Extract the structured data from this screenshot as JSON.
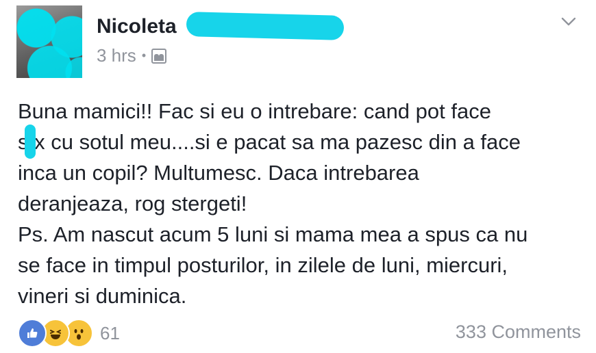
{
  "author": {
    "name": "Nicoleta",
    "time": "3 hrs",
    "separator": "•",
    "privacy_icon": "friends-icon"
  },
  "menu_icon": "chevron-down-icon",
  "post": {
    "lines": [
      "Buna mamici!! Fac si eu o intrebare: cand pot face",
      "s  x cu sotul meu....si e pacat sa ma pazesc din a face",
      "inca un copil? Multumesc. Daca intrebarea",
      "deranjeaza, rog stergeti!",
      "Ps. Am nascut acum 5 luni si mama mea a spus ca nu",
      "se face in timpul posturilor, in zilele de luni, miercuri,",
      "vineri si duminica."
    ]
  },
  "reactions": {
    "icons": [
      "like-icon",
      "haha-icon",
      "wow-icon"
    ],
    "count": "61"
  },
  "comments": {
    "label": "333 Comments"
  },
  "colors": {
    "text": "#1d2129",
    "meta": "#90949c",
    "redaction": "#17d4ea",
    "like": "#4f7dd8",
    "emoji": "#f7c33a"
  }
}
